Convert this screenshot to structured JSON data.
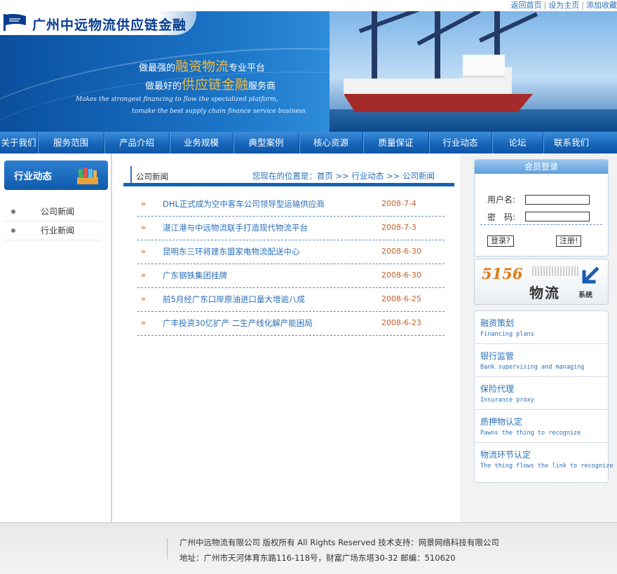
{
  "toplinks": {
    "home": "返回首页",
    "set_home": "设为主页",
    "favorite": "添加收藏"
  },
  "header": {
    "company_name": "广州中远物流供应链金融",
    "slogan1_pre": "做最强的",
    "slogan1_hl": "融资物流",
    "slogan1_post": "专业平台",
    "slogan2_pre": "做最好的",
    "slogan2_hl": "供应链金融",
    "slogan2_post": "服务商",
    "english1": "Makes the strongest financing to flow the specialized platform,",
    "english2": "tomake the best supply chain finance service business"
  },
  "nav": [
    "关于我们",
    "服务范围",
    "产品介绍",
    "业务规模",
    "典型案例",
    "核心资源",
    "质量保证",
    "行业动态",
    "论坛",
    "联系我们"
  ],
  "sidebar": {
    "title": "行业动态",
    "items": [
      "公司新闻",
      "行业新闻"
    ]
  },
  "content": {
    "section_title": "公司新闻",
    "location": "您现在的位置是：首页 >> 行业动态 >> 公司新闻",
    "arrow_glyph": "»",
    "news": [
      {
        "title": "DHL正式成为空中客车公司领导型运输供应商",
        "date": "2008-7-4"
      },
      {
        "title": "湛江港与中远物流联手打造现代物流平台",
        "date": "2008-7-3"
      },
      {
        "title": "昆明东三环将建东盟家电物流配送中心",
        "date": "2008-6-30"
      },
      {
        "title": "广东钢铁集团挂牌",
        "date": "2008-6-30"
      },
      {
        "title": "前5月经广东口岸原油进口量大增逾八成",
        "date": "2008-6-25"
      },
      {
        "title": "广丰投资30亿扩产 二生产线化解产能困局",
        "date": "2008-6-23"
      }
    ]
  },
  "login": {
    "title": "会员登录",
    "username_label": "用户名:",
    "password_label": "密　码:",
    "login_button": "登录?",
    "register_button": "注册!"
  },
  "promo": {
    "number": "5156",
    "text": "物流",
    "suffix": "系统"
  },
  "services": [
    {
      "cn": "融资策划",
      "en": "Financing plans"
    },
    {
      "cn": "银行监管",
      "en": "Bank supervising and managing"
    },
    {
      "cn": "保险代理",
      "en": "Insurance proxy"
    },
    {
      "cn": "质押物认定",
      "en": "Pawns the thing to recognize"
    },
    {
      "cn": "物流环节认定",
      "en": "The thing flows the link to recognize"
    }
  ],
  "footer": {
    "line1": "广州中远物流有限公司  版权所有  All Rights Reserved 技术支持：网景网络科技有限公司",
    "line2": "地址：广州市天河体育东路116-118号，财富广场东塔30-32 邮编：510620"
  },
  "colors": {
    "brand_blue": "#1463b8",
    "highlight_gold": "#f4b93c",
    "date_orange": "#c0612c",
    "link_blue": "#2a6fb8"
  }
}
